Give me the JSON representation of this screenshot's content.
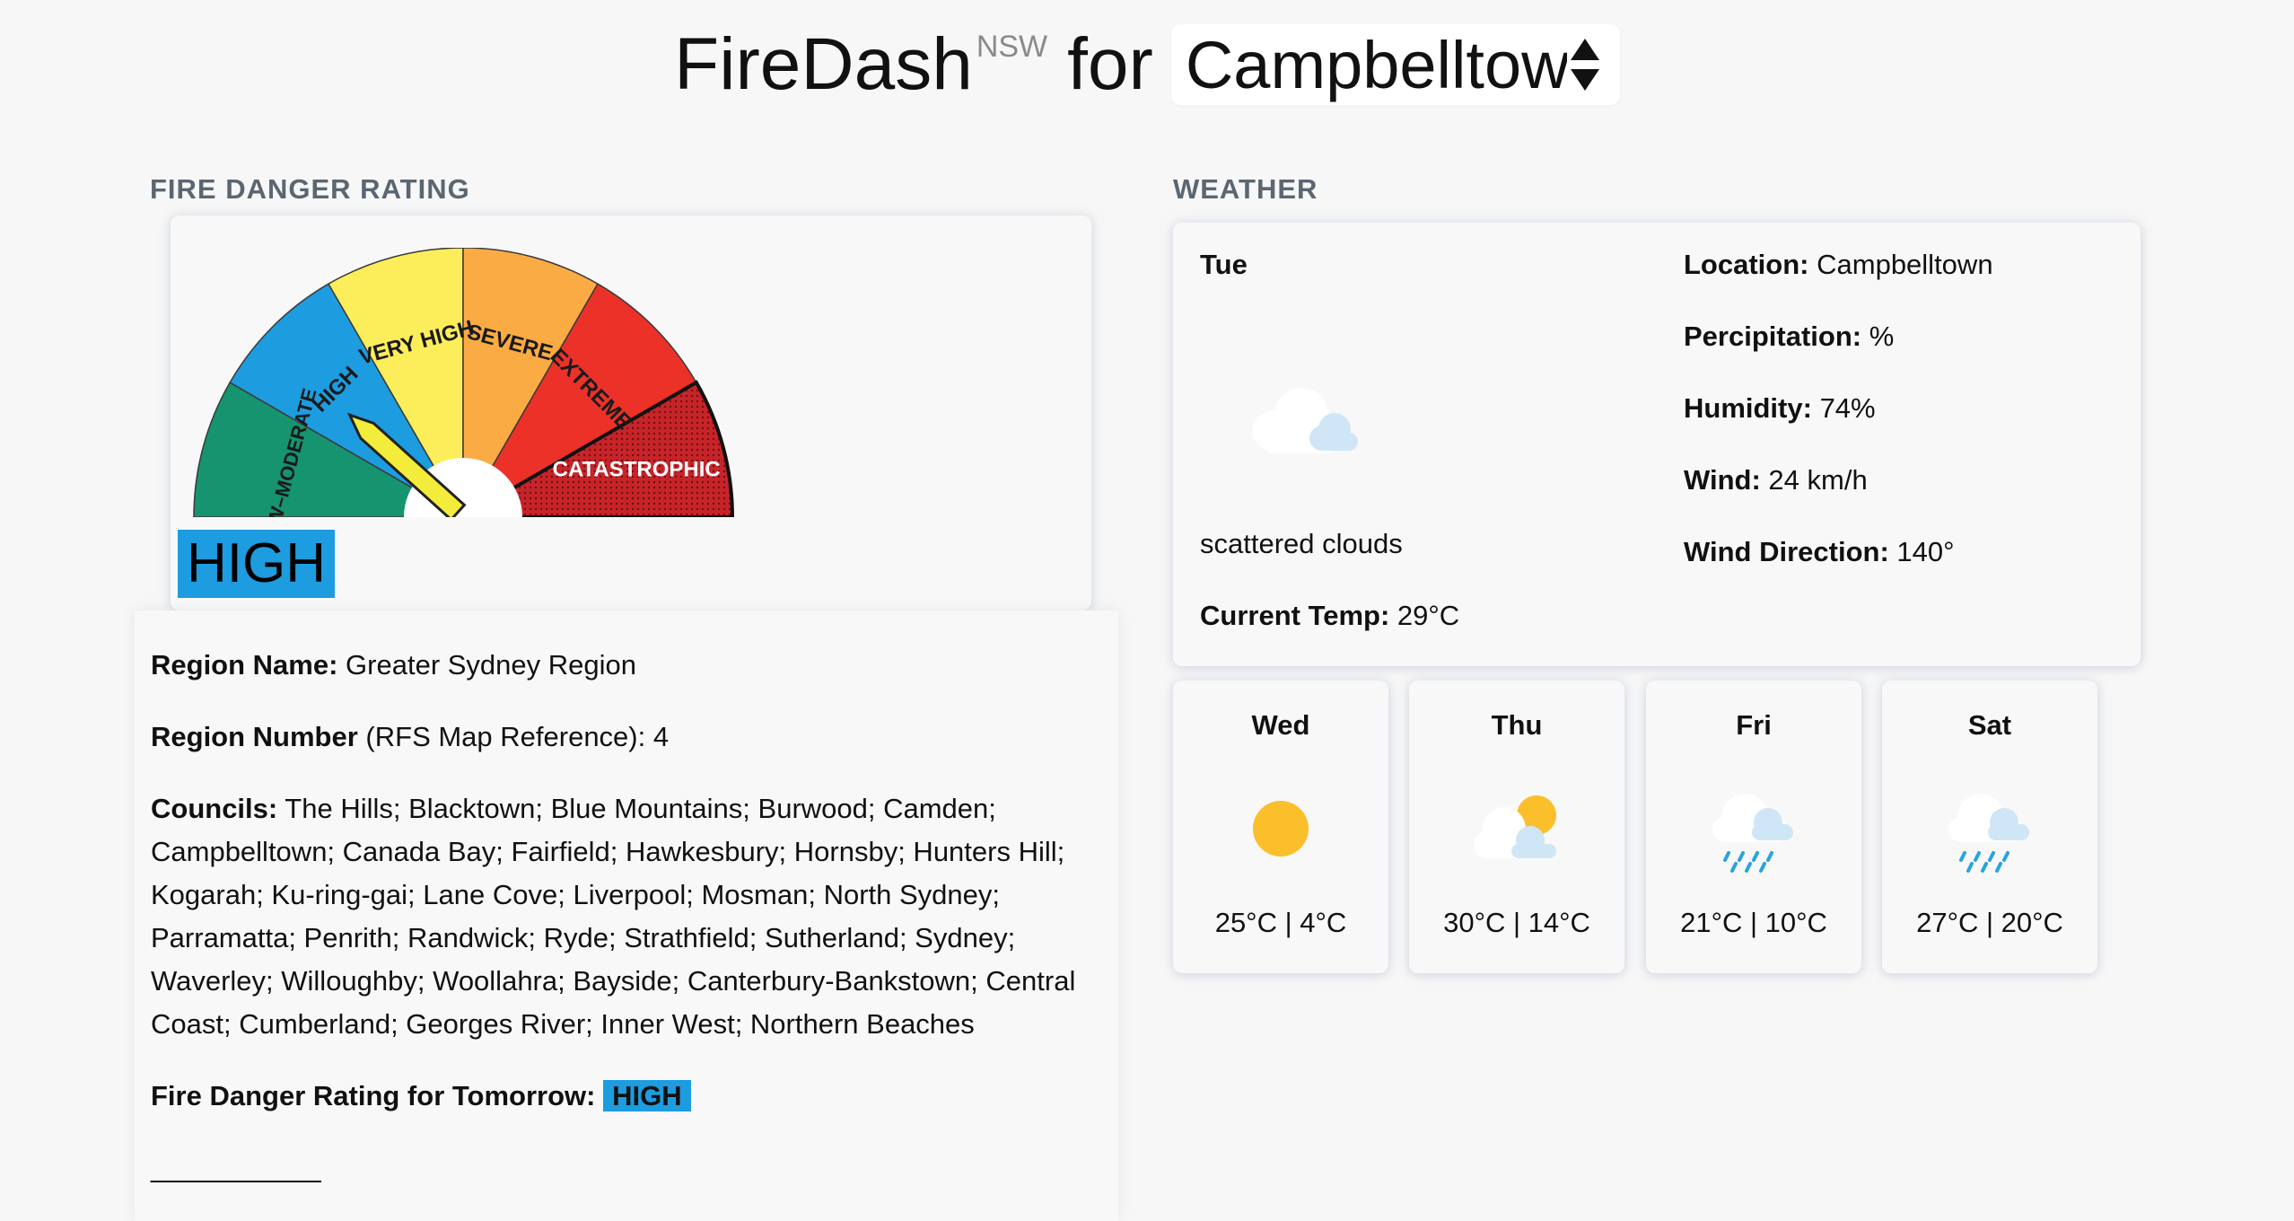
{
  "header": {
    "brand": "FireDash",
    "superscript": "NSW",
    "for_word": "for",
    "location_select_value": "Campbelltown"
  },
  "fire_danger": {
    "section_title": "FIRE DANGER RATING",
    "gauge_labels": [
      "LOW–MODERATE",
      "HIGH",
      "VERY HIGH",
      "SEVERE",
      "EXTREME",
      "CATASTROPHIC"
    ],
    "gauge_colors": {
      "low_moderate": "#16936f",
      "high": "#1d9ce0",
      "very_high": "#fced5a",
      "severe": "#fbab44",
      "extreme": "#ec3129",
      "catastrophic": "#c7242a",
      "needle": "#f4ec3b"
    },
    "current_rating": "HIGH"
  },
  "region": {
    "region_name_label": "Region Name:",
    "region_name_value": "Greater Sydney Region",
    "region_number_label": "Region Number",
    "region_number_value": "(RFS Map Reference): 4",
    "councils_label": "Councils:",
    "councils_value": "The Hills; Blacktown; Blue Mountains; Burwood; Camden; Campbelltown; Canada Bay; Fairfield; Hawkesbury; Hornsby; Hunters Hill; Kogarah; Ku-ring-gai; Lane Cove; Liverpool; Mosman; North Sydney; Parramatta; Penrith; Randwick; Ryde; Strathfield; Sutherland; Sydney; Waverley; Willoughby; Woollahra; Bayside; Canterbury-Bankstown; Central Coast; Cumberland; Georges River; Inner West; Northern Beaches",
    "tomorrow_label": "Fire Danger Rating for Tomorrow:",
    "tomorrow_value": "HIGH",
    "divider_text": "___________"
  },
  "weather": {
    "section_title": "WEATHER",
    "today_day": "Tue",
    "today_icon": "scattered-clouds-icon",
    "today_desc": "scattered clouds",
    "current_temp_label": "Current Temp:",
    "current_temp_value": "29°C",
    "location_label": "Location:",
    "location_value": "Campbelltown",
    "precip_label": "Percipitation:",
    "precip_value": "%",
    "humidity_label": "Humidity:",
    "humidity_value": "74%",
    "wind_label": "Wind:",
    "wind_value": "24 km/h",
    "wind_dir_label": "Wind Direction:",
    "wind_dir_value": "140°"
  },
  "forecast": [
    {
      "day": "Wed",
      "icon": "sunny-icon",
      "temps": "25°C | 4°C"
    },
    {
      "day": "Thu",
      "icon": "partly-cloudy-icon",
      "temps": "30°C | 14°C"
    },
    {
      "day": "Fri",
      "icon": "rain-icon",
      "temps": "21°C | 10°C"
    },
    {
      "day": "Sat",
      "icon": "rain-icon",
      "temps": "27°C | 20°C"
    }
  ]
}
